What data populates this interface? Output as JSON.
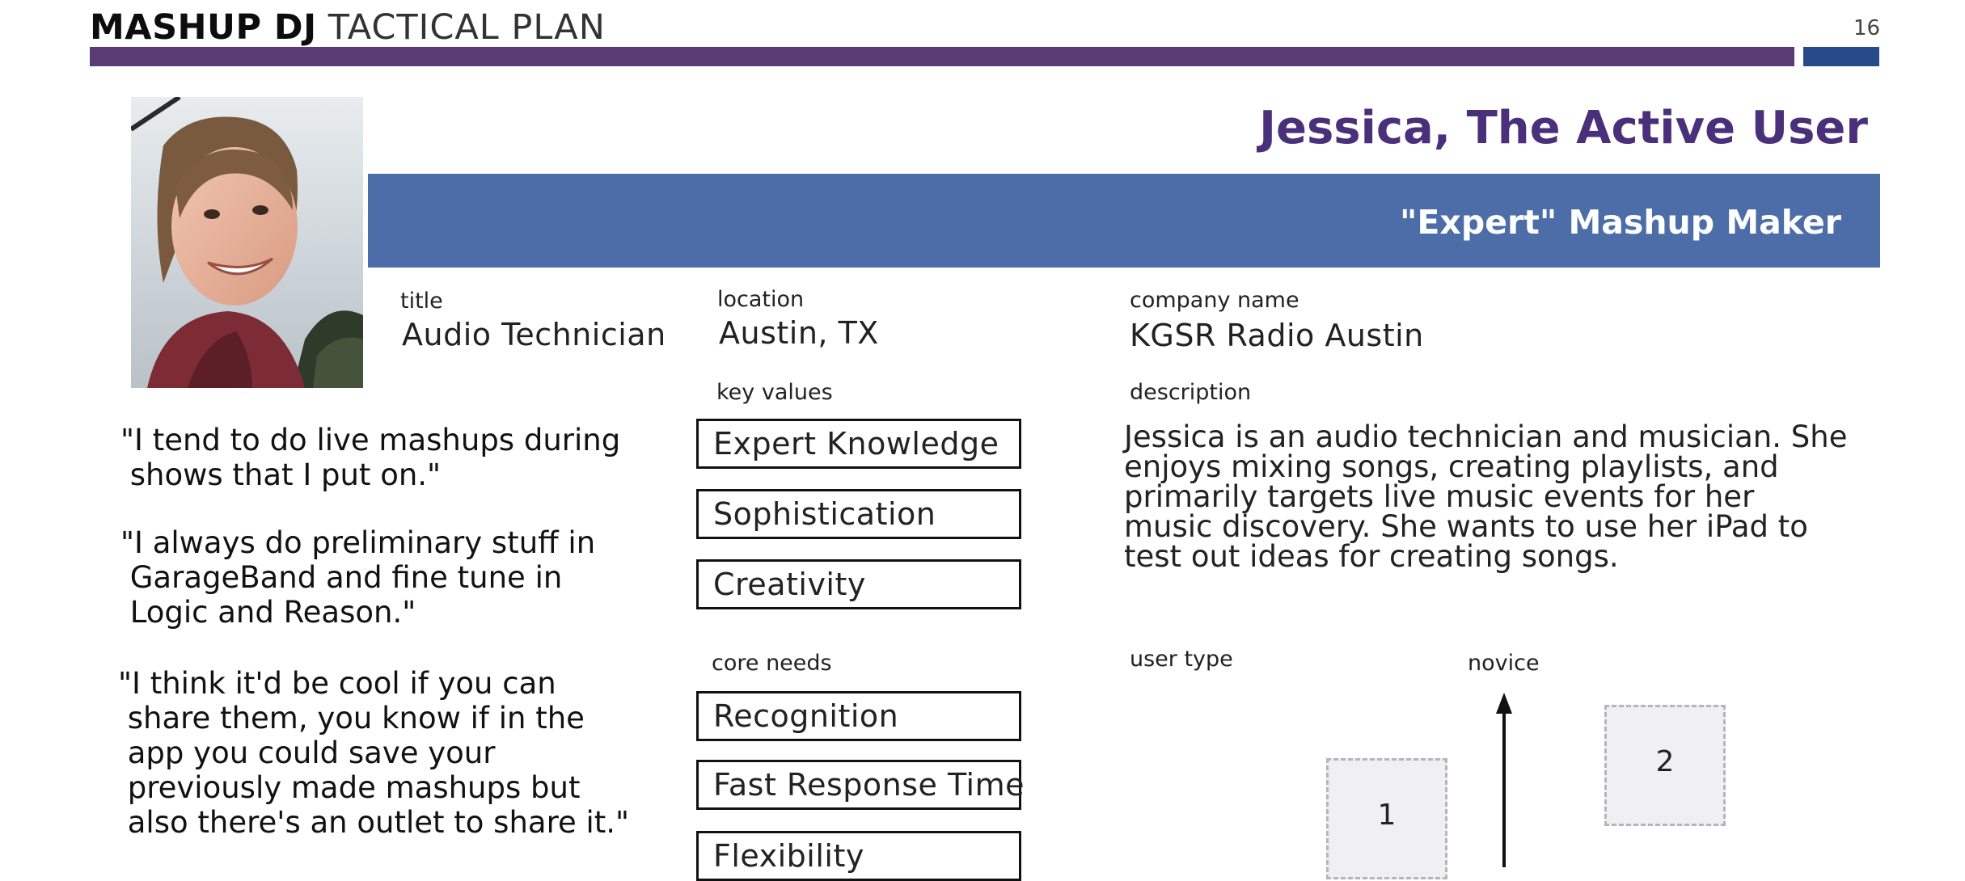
{
  "header": {
    "title_bold": "MASHUP DJ",
    "title_light": "TACTICAL PLAN",
    "page_number": "16",
    "accent_purple": "#593c73",
    "accent_blue": "#264a8a"
  },
  "persona": {
    "name": "Jessica, The Active User",
    "subtitle": "\"Expert\" Mashup Maker",
    "banner_color": "#4c6da8",
    "name_color": "#4a2f7a"
  },
  "fields": {
    "title_label": "title",
    "title_value": "Audio Technician",
    "location_label": "location",
    "location_value": "Austin, TX",
    "company_label": "company name",
    "company_value": "KGSR Radio Austin",
    "description_label": "description",
    "description_text": "Jessica is an audio technician and musician. She enjoys mixing songs, creating playlists, and primarily targets live music events for her music discovery. She wants to use her iPad to test out ideas for creating songs."
  },
  "quotes": [
    "\"I tend to do live mashups during\n shows that I put on.\"",
    "\"I always do preliminary stuff in\n GarageBand and fine tune in\n Logic and Reason.\"",
    "\"I think it'd be cool if you can\n share them, you know if in the\n app you could save your\n previously made mashups but\n also there's an outlet to share it.\""
  ],
  "key_values": {
    "label": "key values",
    "items": [
      "Expert Knowledge",
      "Sophistication",
      "Creativity"
    ]
  },
  "core_needs": {
    "label": "core needs",
    "items": [
      "Recognition",
      "Fast Response Time",
      "Flexibility"
    ]
  },
  "user_type": {
    "label": "user type",
    "axis_top": "novice",
    "box_1": "1",
    "box_2": "2"
  }
}
